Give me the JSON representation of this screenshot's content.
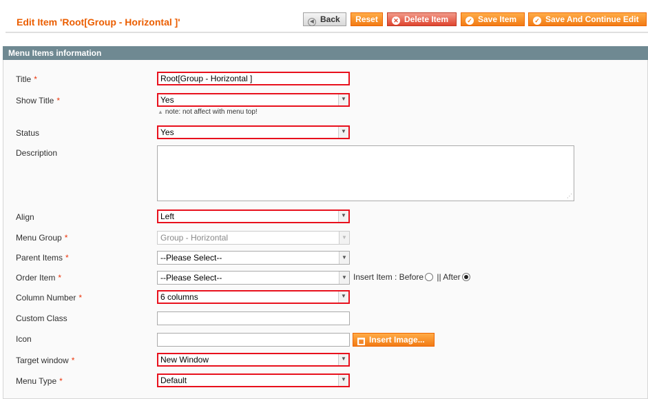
{
  "page": {
    "title": "Edit Item 'Root[Group - Horizontal ]'"
  },
  "toolbar": {
    "back_label": "Back",
    "reset_label": "Reset",
    "delete_label": "Delete Item",
    "save_label": "Save Item",
    "save_continue_label": "Save And Continue Edit"
  },
  "section": {
    "title": "Menu Items information"
  },
  "form": {
    "title": {
      "label": "Title",
      "required": "*",
      "value": "Root[Group - Horizontal ]"
    },
    "show_title": {
      "label": "Show Title",
      "required": "*",
      "value": "Yes",
      "note": "note: not affect with menu top!"
    },
    "status": {
      "label": "Status",
      "value": "Yes"
    },
    "description": {
      "label": "Description",
      "value": ""
    },
    "align": {
      "label": "Align",
      "value": "Left"
    },
    "menu_group": {
      "label": "Menu Group",
      "required": "*",
      "value": "Group - Horizontal"
    },
    "parent_items": {
      "label": "Parent Items",
      "required": "*",
      "value": "--Please Select--"
    },
    "order_item": {
      "label": "Order Item",
      "required": "*",
      "value": "--Please Select--",
      "insert_label": "Insert Item :  Before",
      "after_label": "|| After"
    },
    "column_number": {
      "label": "Column Number",
      "required": "*",
      "value": "6 columns"
    },
    "custom_class": {
      "label": "Custom Class",
      "value": ""
    },
    "icon": {
      "label": "Icon",
      "value": "",
      "button_label": "Insert Image..."
    },
    "target_window": {
      "label": "Target window",
      "required": "*",
      "value": "New Window"
    },
    "menu_type": {
      "label": "Menu Type",
      "required": "*",
      "value": "Default"
    }
  },
  "colors": {
    "accent": "#eb5e00",
    "highlight": "#e8101c",
    "section_bar": "#6f8992"
  }
}
